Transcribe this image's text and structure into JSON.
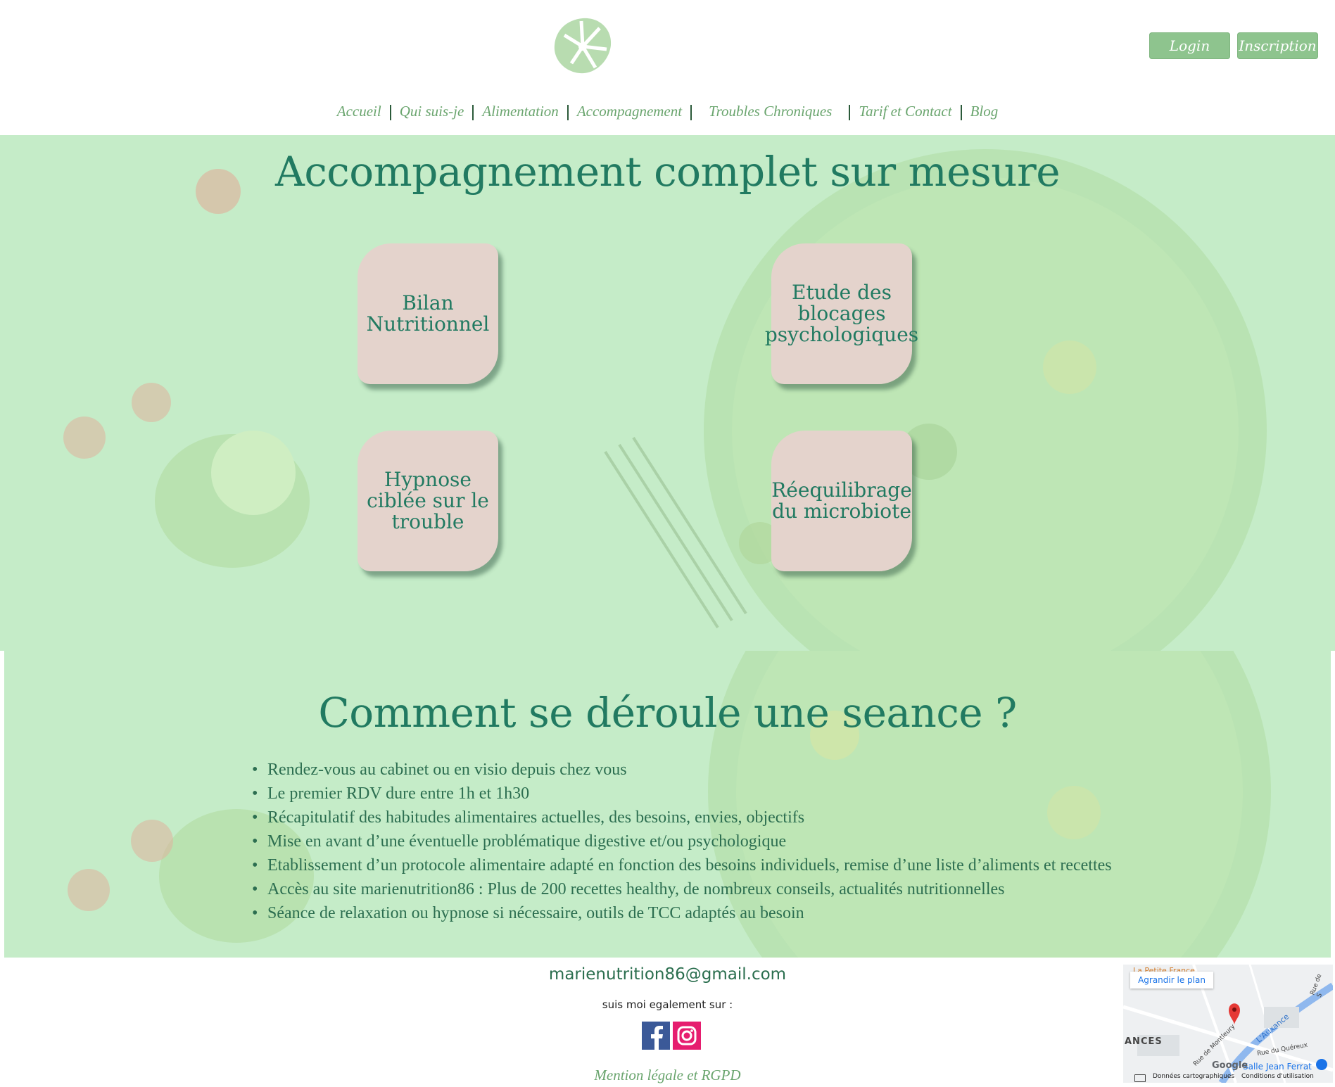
{
  "header": {
    "login_label": "Login",
    "signup_label": "Inscription",
    "logo_icon": "monstera-leaf-icon"
  },
  "nav": {
    "items": [
      "Accueil",
      "Qui suis-je",
      "Alimentation",
      "Accompagnement",
      "Troubles Chroniques",
      "Tarif et Contact",
      "Blog"
    ]
  },
  "section1": {
    "title": "Accompagnement complet sur mesure",
    "cards": [
      {
        "l1": "Bilan",
        "l2": "Nutritionnel",
        "l3": ""
      },
      {
        "l1": "Etude des",
        "l2": "blocages",
        "l3": "psychologiques"
      },
      {
        "l1": "Hypnose",
        "l2": "ciblée sur le",
        "l3": "trouble"
      },
      {
        "l1": "Réequilibrage",
        "l2": "du microbiote",
        "l3": ""
      }
    ]
  },
  "section2": {
    "title": "Comment se déroule une seance ?",
    "items": [
      "Rendez-vous au cabinet ou en visio depuis chez vous",
      "Le premier RDV dure entre 1h et 1h30",
      "Récapitulatif des habitudes alimentaires actuelles, des besoins, envies, objectifs",
      "Mise en avant d’une éventuelle problématique digestive et/ou psychologique",
      "Etablissement d’un protocole alimentaire adapté en fonction des besoins individuels, remise d’une liste d’aliments et recettes",
      "Accès au site marienutrition86 : Plus de 200 recettes healthy, de nombreux conseils, actualités nutritionnelles",
      "Séance de relaxation ou hypnose si nécessaire, outils de TCC adaptés au besoin"
    ]
  },
  "footer": {
    "email": "marienutrition86@gmail.com",
    "follow_text": "suis moi egalement sur :",
    "legal_link": "Mention légale et RGPD",
    "social": [
      "facebook-icon",
      "instagram-icon"
    ],
    "map": {
      "enlarge_label": "Agrandir le plan",
      "place_top": "La Petite France",
      "place_area": "ANCES",
      "river": "L'Auxance",
      "street1": "Rue du Quéreux",
      "street2": "Rue de Montleury",
      "street3": "Rue de S",
      "place_bottom": "Salle Jean Ferrat",
      "brand": "Google",
      "attribution1": "Données cartographiques",
      "attribution2": "Conditions d'utilisation"
    }
  },
  "colors": {
    "accent_green": "#8ec48e",
    "title_green": "#217a61",
    "section_bg": "#c5ecc8",
    "card_bg": "#e4d3cc"
  }
}
